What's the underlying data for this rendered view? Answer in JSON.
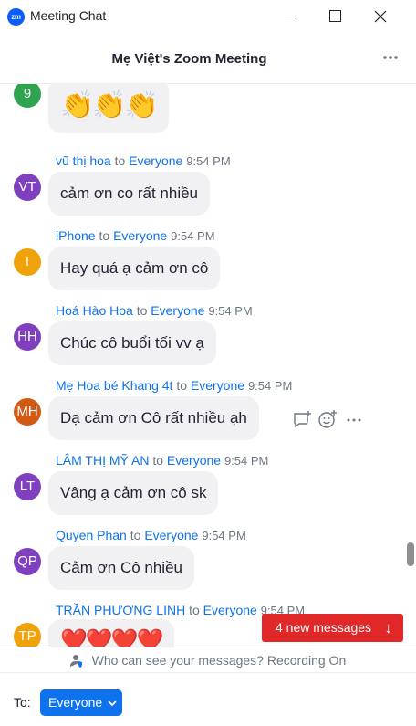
{
  "window": {
    "app_logo": "zm",
    "title": "Meeting Chat"
  },
  "header": {
    "meeting_title": "Mẹ Việt's Zoom Meeting",
    "more_icon": "ellipsis-icon"
  },
  "colors": {
    "accent": "#0e72ed",
    "bubble": "#f1f1f4",
    "alert": "#e02828"
  },
  "messages": [
    {
      "initials": "9",
      "color": "#2ea44f",
      "sender": "",
      "to": "",
      "target": "",
      "time": "",
      "text": "👏👏👏"
    },
    {
      "initials": "VT",
      "color": "#7f3fbf",
      "sender": "vũ thị hoa",
      "to": "to",
      "target": "Everyone",
      "time": "9:54 PM",
      "text": "cảm ơn co rất nhiều"
    },
    {
      "initials": "I",
      "color": "#f0a20a",
      "sender": "iPhone",
      "to": "to",
      "target": "Everyone",
      "time": "9:54 PM",
      "text": "Hay quá ạ cảm ơn cô"
    },
    {
      "initials": "HH",
      "color": "#7f3fbf",
      "sender": "Hoá Hào Hoa",
      "to": "to",
      "target": "Everyone",
      "time": "9:54 PM",
      "text": "Chúc cô buổi tối vv ạ"
    },
    {
      "initials": "MH",
      "color": "#d25a12",
      "sender": "Mẹ Hoa bé Khang 4t",
      "to": "to",
      "target": "Everyone",
      "time": "9:54 PM",
      "text": "Dạ cảm ơn Cô rất nhiều ạh"
    },
    {
      "initials": "LT",
      "color": "#7f3fbf",
      "sender": "LÂM THỊ MỸ AN",
      "to": "to",
      "target": "Everyone",
      "time": "9:54 PM",
      "text": "Vâng ạ cảm ơn cô sk"
    },
    {
      "initials": "QP",
      "color": "#7f3fbf",
      "sender": "Quyen Phan",
      "to": "to",
      "target": "Everyone",
      "time": "9:54 PM",
      "text": "Cảm ơn Cô nhiều"
    },
    {
      "initials": "TP",
      "color": "#f0a20a",
      "sender": "TRẦN PHƯƠNG LINH",
      "to": "to",
      "target": "Everyone",
      "time": "9:54 PM",
      "text": "❤️❤️❤️❤️"
    }
  ],
  "message_actions": [
    "reply-icon",
    "reaction-icon",
    "more-icon"
  ],
  "new_messages": {
    "label": "4 new messages",
    "icon": "arrow-down-icon"
  },
  "privacy": {
    "icon": "user-shield-icon",
    "text": "Who can see your messages? Recording On"
  },
  "composer": {
    "to_label": "To:",
    "recipient": "Everyone",
    "chevron": "chevron-down-icon"
  }
}
